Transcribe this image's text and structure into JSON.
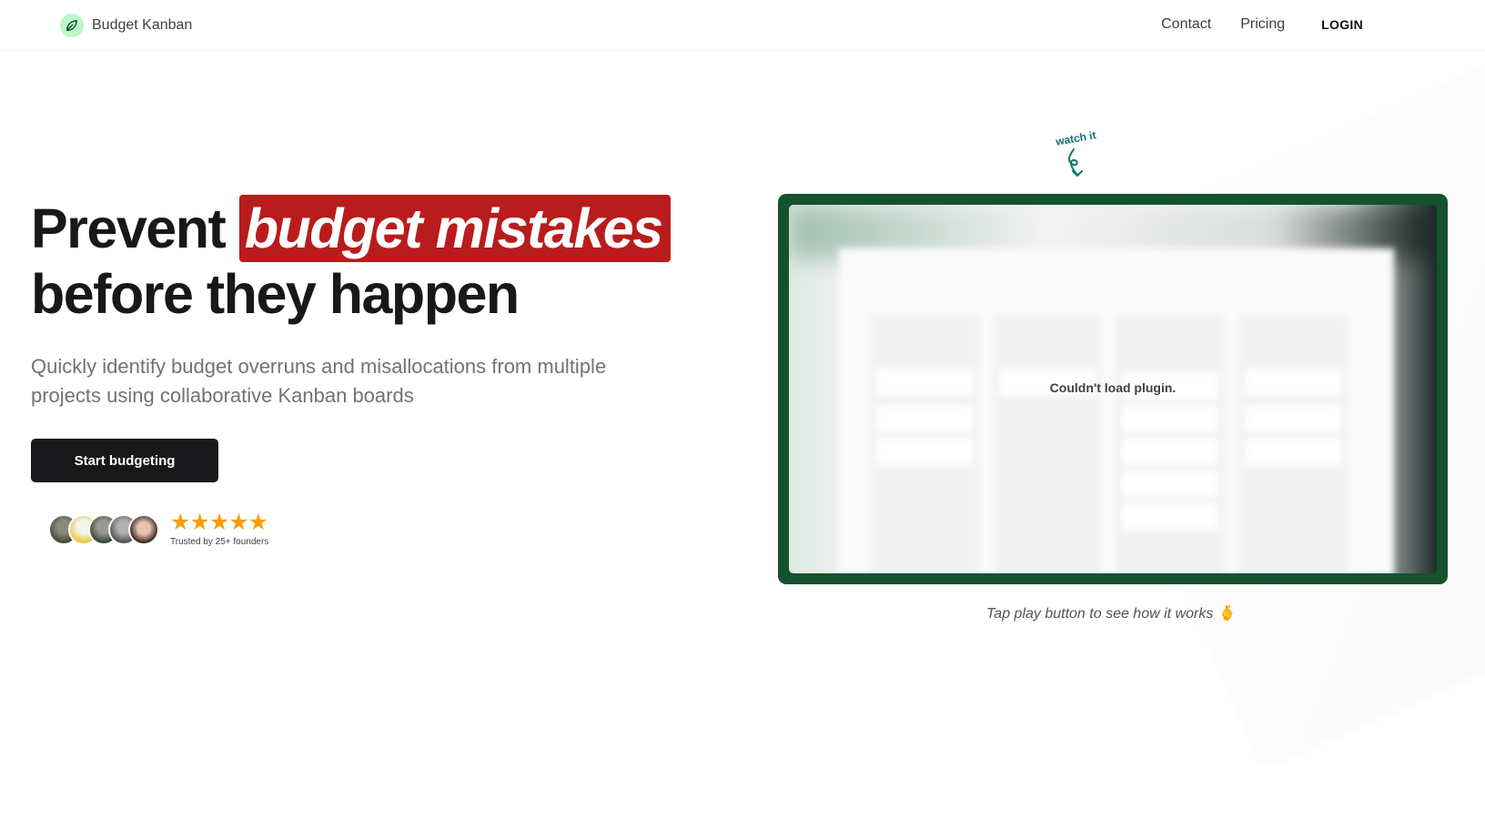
{
  "header": {
    "brand": "Budget Kanban",
    "nav": {
      "contact": "Contact",
      "pricing": "Pricing",
      "login": "LOGIN"
    }
  },
  "hero": {
    "title_start": "Prevent ",
    "title_highlight": "budget mistakes",
    "title_end": "before they happen",
    "subtitle": "Quickly identify budget overruns and misallocations from multiple projects using collaborative Kanban boards",
    "cta": "Start budgeting",
    "stars": "★★★★★",
    "trusted": "Trusted by 25+ founders"
  },
  "video": {
    "watch_label": "watch it",
    "error": "Couldn't load plugin.",
    "caption": "Tap play button to see how it works 🫰"
  },
  "colors": {
    "accent_red": "#b91c1c",
    "frame_green": "#14532d",
    "cta_bg": "#18181b",
    "star": "#f59e0b",
    "watch_teal": "#0f766e"
  }
}
